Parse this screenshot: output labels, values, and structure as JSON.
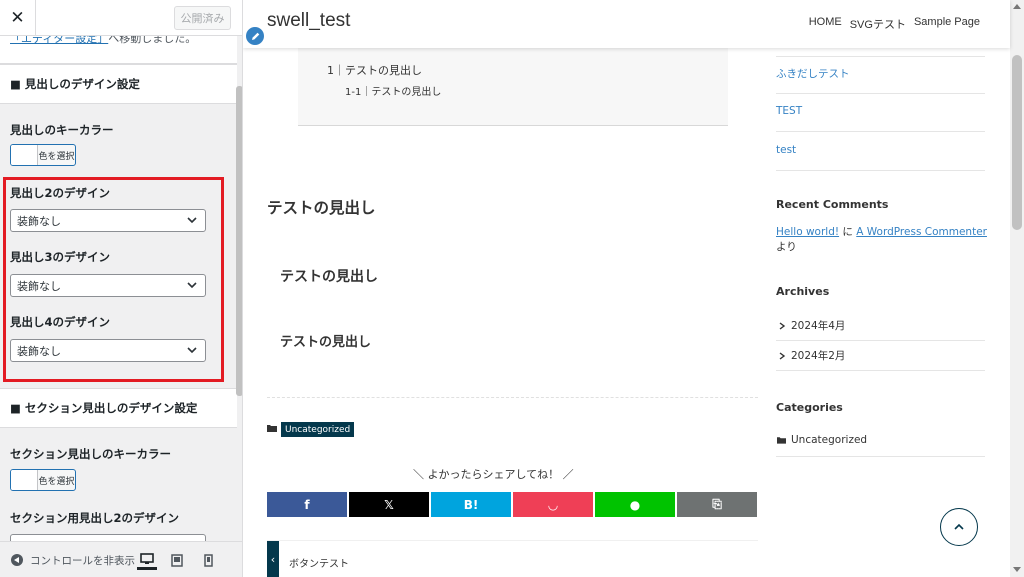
{
  "customizer": {
    "close_label": "✕",
    "publish_label": "公開済み",
    "notice_link": "「エディター設定」",
    "notice_rest": "へ移動しました。",
    "sections": {
      "heading_design_title": "■ 見出しのデザイン設定",
      "section_heading_design_title": "■ セクション見出しのデザイン設定"
    },
    "controls": {
      "heading_key_color_label": "見出しのキーカラー",
      "color_picker_label": "色を選択",
      "h2_design_label": "見出し2のデザイン",
      "h2_design_value": "装飾なし",
      "h3_design_label": "見出し3のデザイン",
      "h3_design_value": "装飾なし",
      "h4_design_label": "見出し4のデザイン",
      "h4_design_value": "装飾なし",
      "section_key_color_label": "セクション見出しのキーカラー",
      "section_h2_design_label": "セクション用見出し2のデザイン"
    },
    "footer": {
      "hide_controls_label": "コントロールを非表示"
    }
  },
  "site": {
    "title": "swell_test",
    "nav": [
      "HOME",
      "SVGテスト",
      "Sample Page"
    ],
    "toc": {
      "item1": "1｜テストの見出し",
      "item1_1": "1-1｜テストの見出し"
    },
    "headings": {
      "h2": "テストの見出し",
      "h3": "テストの見出し",
      "h4": "テストの見出し"
    },
    "category_badge": "Uncategorized",
    "share_title": "＼ よかったらシェアしてね！ ／",
    "prev_post_label": "ボタンテスト",
    "share_buttons": [
      {
        "name": "facebook",
        "glyph": "f",
        "color": "#3b5998"
      },
      {
        "name": "x",
        "glyph": "𝕏",
        "color": "#000000"
      },
      {
        "name": "hatena",
        "glyph": "B!",
        "color": "#00a4de"
      },
      {
        "name": "pocket",
        "glyph": "◡",
        "color": "#ef3f56"
      },
      {
        "name": "line",
        "glyph": "●",
        "color": "#00c300"
      },
      {
        "name": "copy",
        "glyph": "⎘",
        "color": "#6e7272"
      }
    ]
  },
  "widgets": {
    "pages": [
      "ふきだしテスト",
      "TEST",
      "test"
    ],
    "recent_comments_title": "Recent Comments",
    "comment_link": "Hello world!",
    "comment_join": " に ",
    "comment_author": "A WordPress Commenter",
    "comment_tail": " より",
    "archives_title": "Archives",
    "archives": [
      "2024年4月",
      "2024年2月"
    ],
    "categories_title": "Categories",
    "categories": [
      "Uncategorized"
    ]
  },
  "colors": {
    "highlight": "#e31b23",
    "accent": "#04384c",
    "link": "#3582c4"
  }
}
